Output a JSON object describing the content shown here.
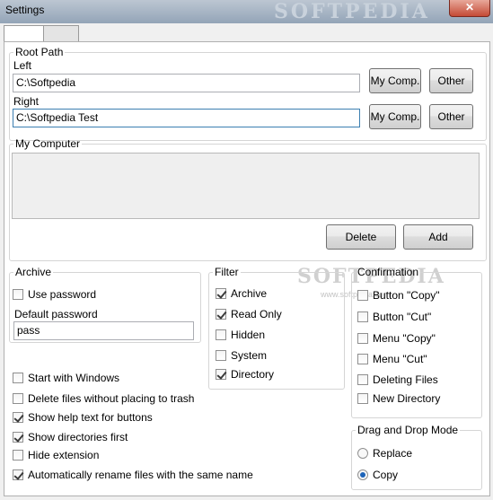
{
  "window": {
    "title": "Settings",
    "close_glyph": "✕",
    "watermark": "SOFTPEDIA"
  },
  "root_path": {
    "legend": "Root Path",
    "left": {
      "label": "Left",
      "value": "C:\\Softpedia",
      "mycomp_label": "My Comp.",
      "other_label": "Other"
    },
    "right": {
      "label": "Right",
      "value": "C:\\Softpedia Test",
      "mycomp_label": "My Comp.",
      "other_label": "Other"
    }
  },
  "my_computer": {
    "legend": "My Computer",
    "delete_label": "Delete",
    "add_label": "Add",
    "watermark": "SOFTPEDIA",
    "watermark_sub": "www.softpedia.com"
  },
  "archive": {
    "legend": "Archive",
    "use_password": {
      "label": "Use password",
      "checked": false
    },
    "default_password_label": "Default password",
    "default_password_value": "pass"
  },
  "filter": {
    "legend": "Filter",
    "items": [
      {
        "label": "Archive",
        "checked": true
      },
      {
        "label": "Read Only",
        "checked": true
      },
      {
        "label": "Hidden",
        "checked": false
      },
      {
        "label": "System",
        "checked": false
      },
      {
        "label": "Directory",
        "checked": true
      }
    ]
  },
  "confirmation": {
    "legend": "Confirmation",
    "items": [
      {
        "label": "Button \"Copy\"",
        "checked": false
      },
      {
        "label": "Button \"Cut\"",
        "checked": false
      },
      {
        "label": "Menu \"Copy\"",
        "checked": false
      },
      {
        "label": "Menu \"Cut\"",
        "checked": false
      },
      {
        "label": "Deleting Files",
        "checked": false
      },
      {
        "label": "New Directory",
        "checked": false
      }
    ]
  },
  "options": [
    {
      "label": "Start with Windows",
      "checked": false
    },
    {
      "label": "Delete files without placing to trash",
      "checked": false
    },
    {
      "label": "Show help text for buttons",
      "checked": true
    },
    {
      "label": "Show directories first",
      "checked": true
    },
    {
      "label": "Hide extension",
      "checked": false
    },
    {
      "label": "Automatically rename files with the same name",
      "checked": true
    }
  ],
  "drag_drop": {
    "legend": "Drag and Drop Mode",
    "options": [
      {
        "label": "Replace",
        "selected": false
      },
      {
        "label": "Copy",
        "selected": true
      }
    ]
  }
}
